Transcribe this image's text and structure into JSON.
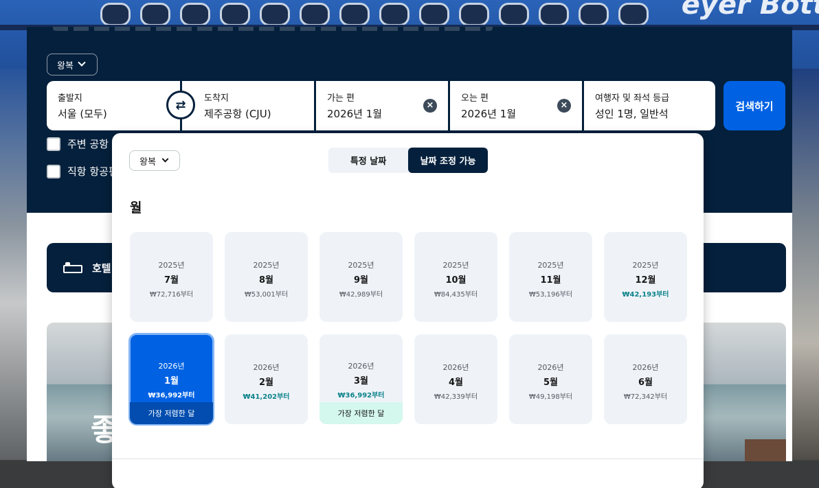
{
  "background": {
    "brand_fragment": "eyer Bott"
  },
  "search": {
    "trip_type": "왕복",
    "origin": {
      "label": "출발지",
      "value": "서울 (모두)"
    },
    "destination": {
      "label": "도착지",
      "value": "제주공항 (CJU)"
    },
    "depart": {
      "label": "가는 편",
      "value": "2026년 1월"
    },
    "return": {
      "label": "오는 편",
      "value": "2026년 1월"
    },
    "travelers": {
      "label": "여행자 및 좌석 등급",
      "value": "성인 1명, 일반석"
    },
    "search_button": "검색하기",
    "swap_icon": "⇄",
    "clear_icon": "×"
  },
  "checkboxes": {
    "nearby": "주변 공항 추",
    "direct": "직항 항공편"
  },
  "hotel_bar": {
    "label": "호텔"
  },
  "banner": {
    "text": "좋"
  },
  "picker": {
    "trip_type": "왕복",
    "toggle": {
      "specific": "특정 날짜",
      "flexible": "날짜 조정 가능"
    },
    "section_title": "월",
    "months": [
      {
        "year": "2025년",
        "month": "7월",
        "price": "₩72,716부터"
      },
      {
        "year": "2025년",
        "month": "8월",
        "price": "₩53,001부터"
      },
      {
        "year": "2025년",
        "month": "9월",
        "price": "₩42,989부터"
      },
      {
        "year": "2025년",
        "month": "10월",
        "price": "₩84,435부터"
      },
      {
        "year": "2025년",
        "month": "11월",
        "price": "₩53,196부터"
      },
      {
        "year": "2025년",
        "month": "12월",
        "price": "₩42,193부터"
      },
      {
        "year": "2026년",
        "month": "1월",
        "price": "₩36,992부터",
        "badge": "가장 저렴한 달"
      },
      {
        "year": "2026년",
        "month": "2월",
        "price": "₩41,202부터"
      },
      {
        "year": "2026년",
        "month": "3월",
        "price": "₩36,992부터",
        "badge": "가장 저렴한 달"
      },
      {
        "year": "2026년",
        "month": "4월",
        "price": "₩42,339부터"
      },
      {
        "year": "2026년",
        "month": "5월",
        "price": "₩49,198부터"
      },
      {
        "year": "2026년",
        "month": "6월",
        "price": "₩72,342부터"
      }
    ]
  },
  "colors": {
    "navy": "#05203c",
    "primary_blue": "#0062e3",
    "cheap_teal": "#0c838a",
    "badge_mint": "#d4f7ee"
  }
}
